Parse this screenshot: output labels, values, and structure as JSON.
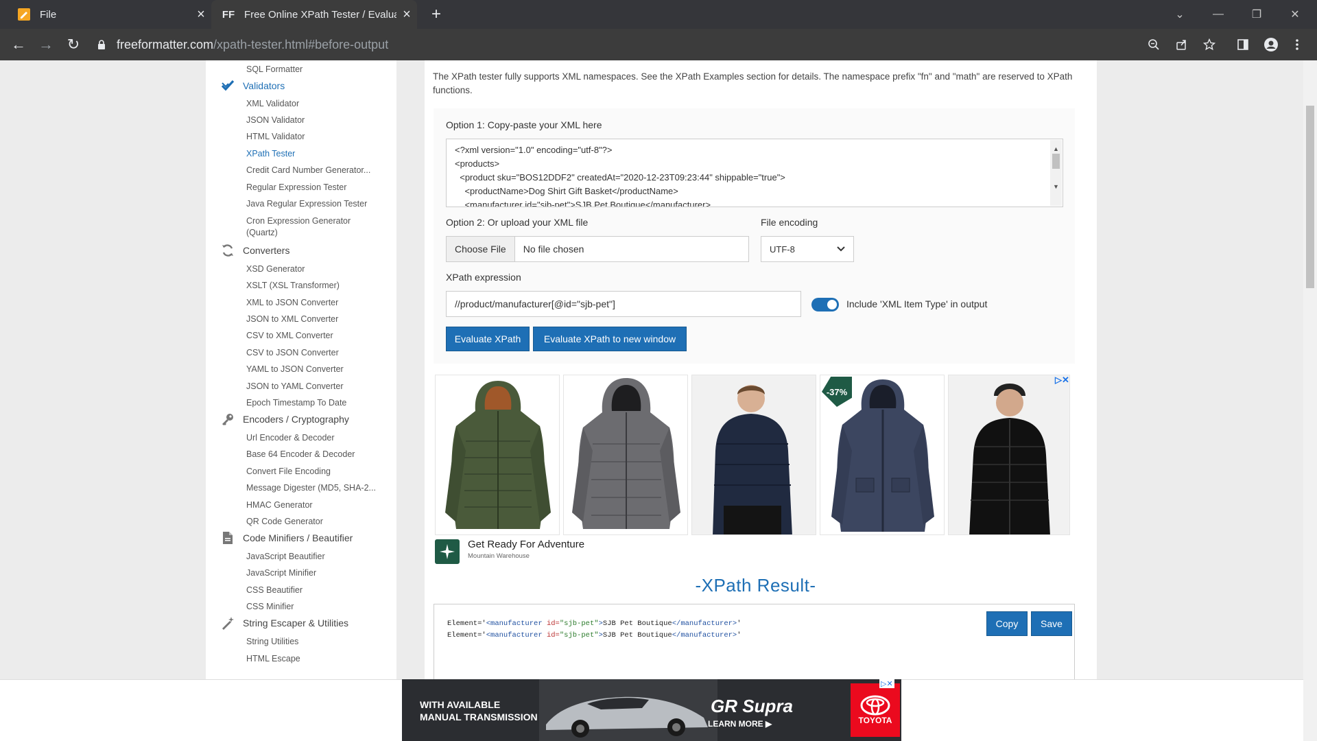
{
  "browser": {
    "tabs": [
      {
        "title": "File",
        "active": false
      },
      {
        "title": "Free Online XPath Tester / Evaluator",
        "active": true,
        "favicon_text": "FF"
      }
    ],
    "url_host": "freeformatter.com",
    "url_path": "/xpath-tester.html#before-output"
  },
  "sidebar": {
    "items": [
      {
        "type": "link",
        "label": "SQL Formatter"
      },
      {
        "type": "category",
        "label": "Validators",
        "icon": "checkmark-icon",
        "active": true
      },
      {
        "type": "link",
        "label": "XML Validator"
      },
      {
        "type": "link",
        "label": "JSON Validator"
      },
      {
        "type": "link",
        "label": "HTML Validator"
      },
      {
        "type": "link",
        "label": "XPath Tester",
        "active": true
      },
      {
        "type": "link",
        "label": "Credit Card Number Generator..."
      },
      {
        "type": "link",
        "label": "Regular Expression Tester"
      },
      {
        "type": "link",
        "label": "Java Regular Expression Tester"
      },
      {
        "type": "link",
        "label": "Cron Expression Generator"
      },
      {
        "type": "link",
        "label": "(Quartz)"
      },
      {
        "type": "category",
        "label": "Converters",
        "icon": "refresh-icon"
      },
      {
        "type": "link",
        "label": "XSD Generator"
      },
      {
        "type": "link",
        "label": "XSLT (XSL Transformer)"
      },
      {
        "type": "link",
        "label": "XML to JSON Converter"
      },
      {
        "type": "link",
        "label": "JSON to XML Converter"
      },
      {
        "type": "link",
        "label": "CSV to XML Converter"
      },
      {
        "type": "link",
        "label": "CSV to JSON Converter"
      },
      {
        "type": "link",
        "label": "YAML to JSON Converter"
      },
      {
        "type": "link",
        "label": "JSON to YAML Converter"
      },
      {
        "type": "link",
        "label": "Epoch Timestamp To Date"
      },
      {
        "type": "category",
        "label": "Encoders / Cryptography",
        "icon": "key-icon"
      },
      {
        "type": "link",
        "label": "Url Encoder & Decoder"
      },
      {
        "type": "link",
        "label": "Base 64 Encoder & Decoder"
      },
      {
        "type": "link",
        "label": "Convert File Encoding"
      },
      {
        "type": "link",
        "label": "Message Digester (MD5, SHA-2..."
      },
      {
        "type": "link",
        "label": "HMAC Generator"
      },
      {
        "type": "link",
        "label": "QR Code Generator"
      },
      {
        "type": "category",
        "label": "Code Minifiers / Beautifier",
        "icon": "file-icon"
      },
      {
        "type": "link",
        "label": "JavaScript Beautifier"
      },
      {
        "type": "link",
        "label": "JavaScript Minifier"
      },
      {
        "type": "link",
        "label": "CSS Beautifier"
      },
      {
        "type": "link",
        "label": "CSS Minifier"
      },
      {
        "type": "category",
        "label": "String Escaper & Utilities",
        "icon": "magic-wand-icon"
      },
      {
        "type": "link",
        "label": "String Utilities"
      },
      {
        "type": "link",
        "label": "HTML Escape"
      }
    ]
  },
  "main": {
    "intro": "The XPath tester fully supports XML namespaces. See the XPath Examples section for details. The namespace prefix \"fn\" and \"math\" are reserved to XPath functions.",
    "option1_label": "Option 1: Copy-paste your XML here",
    "xml_lines": [
      "<?xml version=\"1.0\" encoding=\"utf-8\"?>",
      "<products>",
      "  <product sku=\"BOS12DDF2\" createdAt=\"2020-12-23T09:23:44\" shippable=\"true\">",
      "    <productName>Dog Shirt Gift Basket</productName>",
      "    <manufacturer id=\"sjb-pet\">SJB Pet Boutique</manufacturer>"
    ],
    "option2_label": "Option 2: Or upload your XML file",
    "choose_file": "Choose File",
    "file_status": "No file chosen",
    "encoding_label": "File encoding",
    "encoding_value": "UTF-8",
    "xpath_label": "XPath expression",
    "xpath_value": "//product/manufacturer[@id=\"sjb-pet\"]",
    "include_type_label": "Include 'XML Item Type' in output",
    "include_type_on": true,
    "evaluate_label": "Evaluate XPath",
    "evaluate_new_label": "Evaluate XPath to new window"
  },
  "ad1": {
    "badge": "-37%",
    "title": "Get Ready For Adventure",
    "advertiser": "Mountain Warehouse"
  },
  "result": {
    "title": "-XPath Result-",
    "copy_label": "Copy",
    "save_label": "Save",
    "lines": [
      {
        "prefix": "Element='",
        "open_tag": "<manufacturer",
        "attr": "id=",
        "val": "\"sjb-pet\"",
        "close": ">",
        "text": "SJB Pet Boutique",
        "end_tag": "</manufacturer>",
        "suffix": "'"
      },
      {
        "prefix": "Element='",
        "open_tag": "<manufacturer",
        "attr": "id=",
        "val": "\"sjb-pet\"",
        "close": ">",
        "text": "SJB Pet Boutique",
        "end_tag": "</manufacturer>",
        "suffix": "'"
      }
    ]
  },
  "ad2": {
    "line1": "WITH AVAILABLE",
    "line2": "MANUAL TRANSMISSION",
    "model": "GR Supra",
    "learn": "LEARN MORE ▶",
    "brand": "TOYOTA"
  },
  "colors": {
    "accent": "#1e6fb5",
    "chrome_dark": "#35363a",
    "toolbar": "#3c3c3c"
  }
}
